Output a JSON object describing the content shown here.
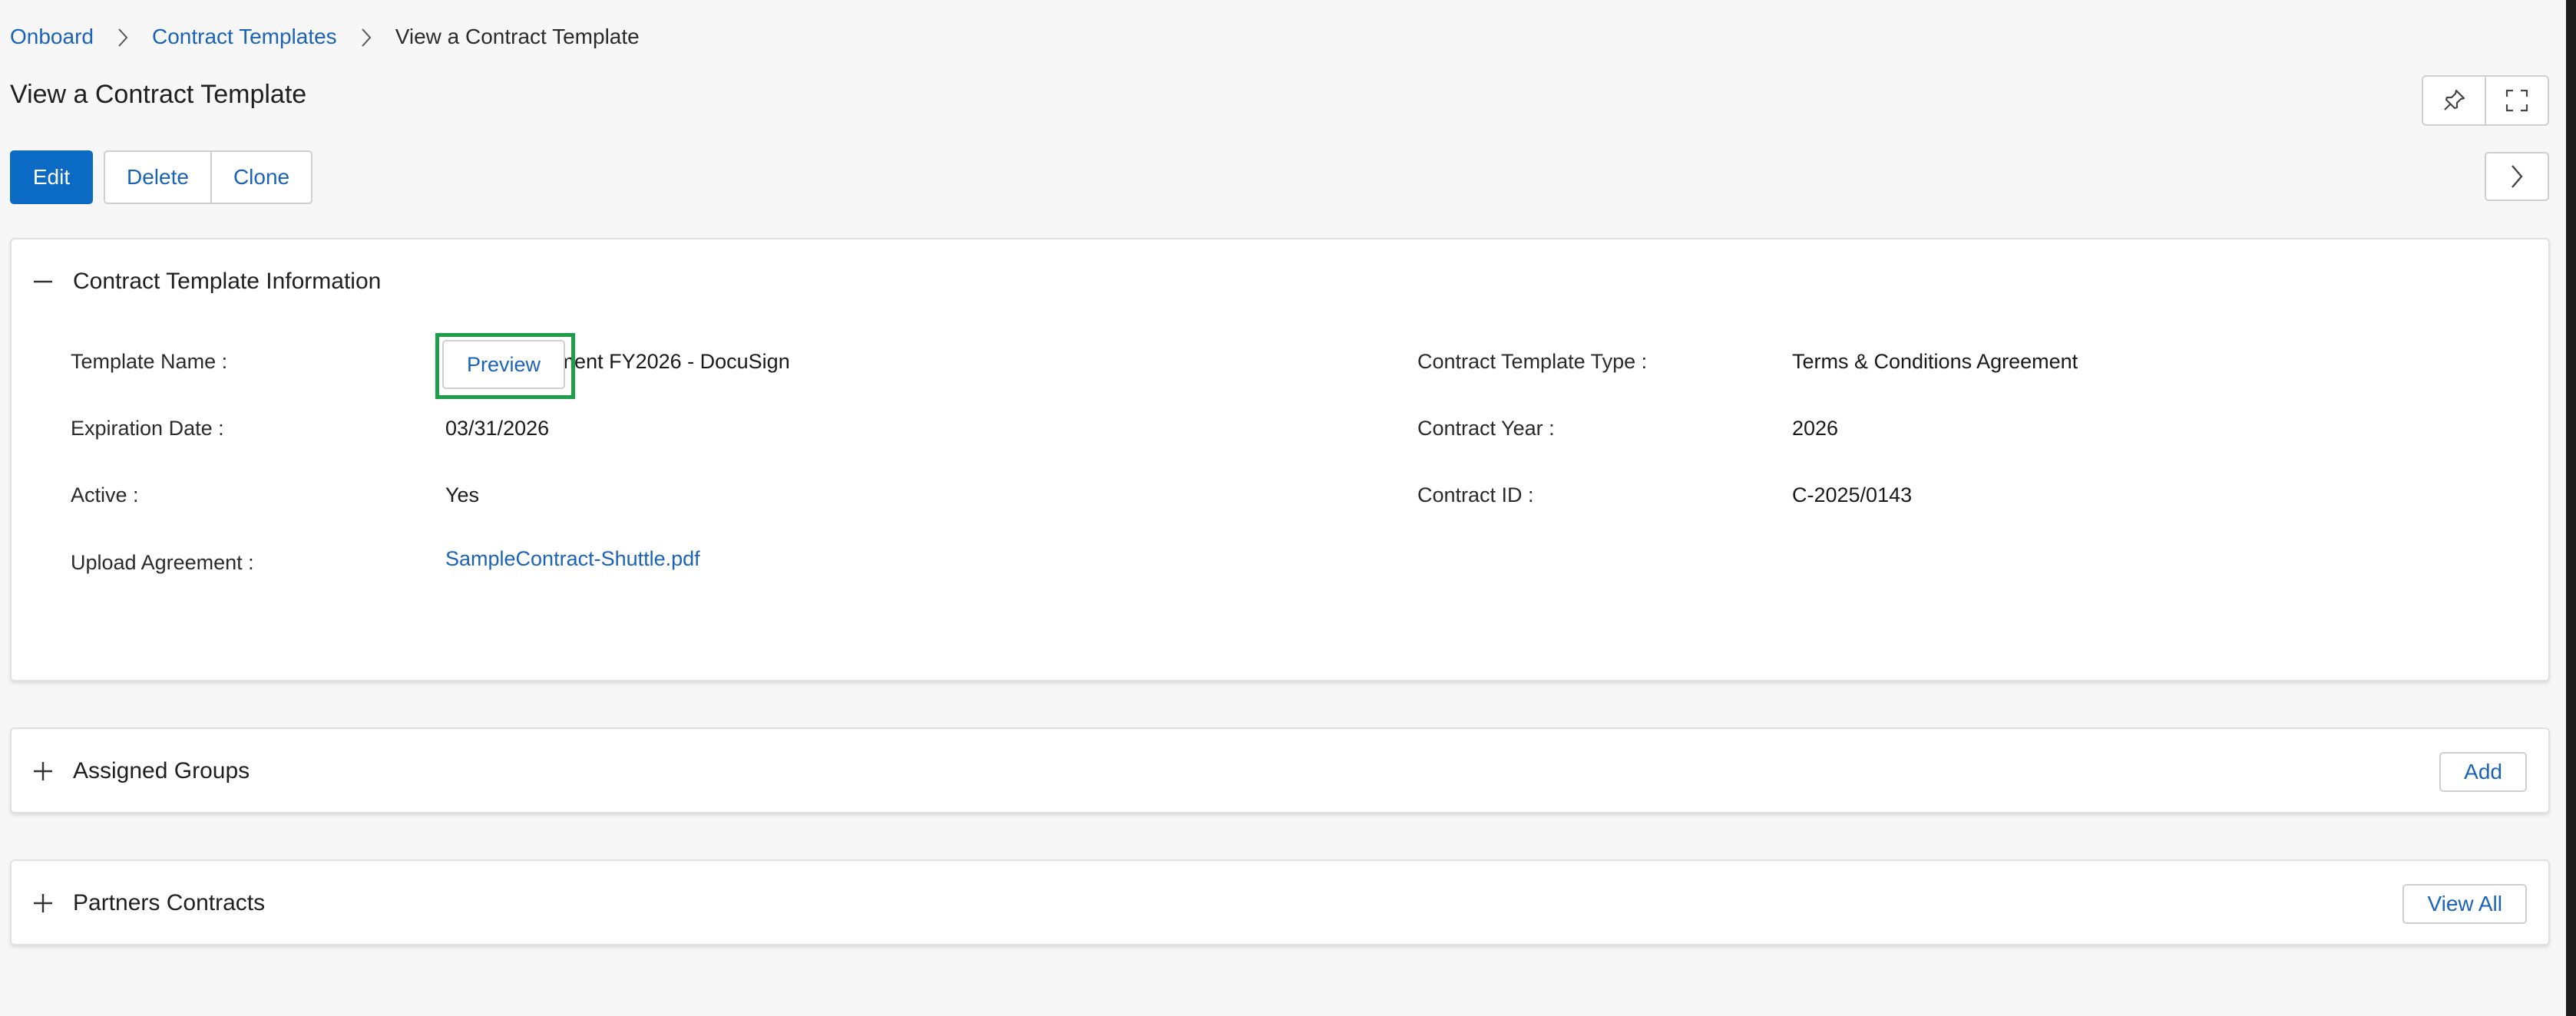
{
  "breadcrumb": {
    "items": [
      "Onboard",
      "Contract Templates"
    ],
    "current": "View a Contract Template"
  },
  "page": {
    "title": "View a Contract Template"
  },
  "toolbar": {
    "edit_label": "Edit",
    "delete_label": "Delete",
    "clone_label": "Clone"
  },
  "header_icons": [
    "pin-icon",
    "fullscreen-icon",
    "chevron-right-icon"
  ],
  "info_section": {
    "title": "Contract Template Information",
    "fields": {
      "template_name": {
        "label": "Template Name :",
        "value": "T&Cs Agreement FY2026 - DocuSign"
      },
      "contract_template_type": {
        "label": "Contract Template Type :",
        "value": "Terms & Conditions Agreement"
      },
      "expiration_date": {
        "label": "Expiration Date :",
        "value": "03/31/2026"
      },
      "contract_year": {
        "label": "Contract Year :",
        "value": "2026"
      },
      "active": {
        "label": "Active :",
        "value": "Yes"
      },
      "contract_id": {
        "label": "Contract ID :",
        "value": "C-2025/0143"
      },
      "upload_agreement": {
        "label": "Upload Agreement :",
        "file": "SampleContract-Shuttle.pdf",
        "preview_label": "Preview"
      }
    }
  },
  "assigned_groups": {
    "title": "Assigned Groups",
    "action_label": "Add"
  },
  "partners_contracts": {
    "title": "Partners Contracts",
    "action_label": "View All"
  },
  "colors": {
    "primary": "#0b6ac3",
    "link": "#1a63b8",
    "highlight": "#1e9e4a"
  }
}
